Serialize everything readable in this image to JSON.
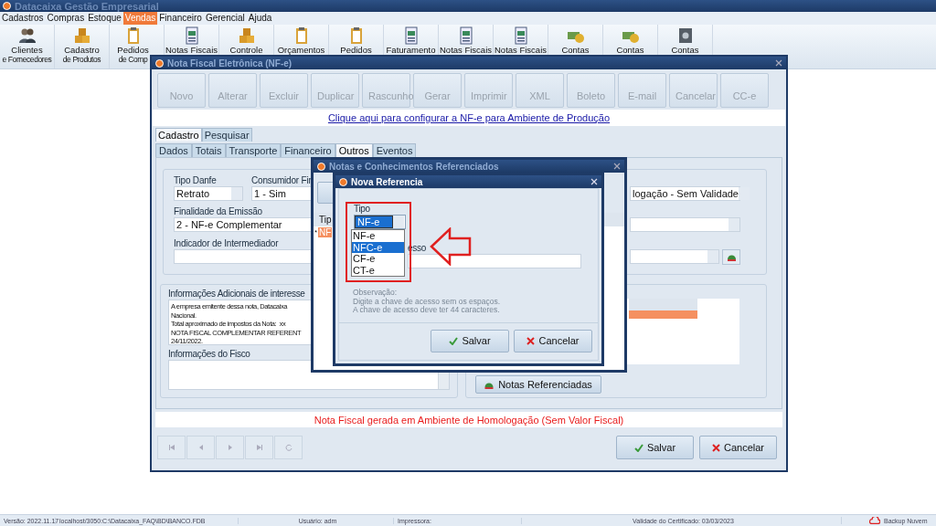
{
  "app": {
    "title": "Datacaixa Gestão Empresarial"
  },
  "menu": [
    {
      "label": "Cadastros",
      "selected": false
    },
    {
      "label": "Compras",
      "selected": false
    },
    {
      "label": "Estoque",
      "selected": false
    },
    {
      "label": "Vendas",
      "selected": true
    },
    {
      "label": "Financeiro",
      "selected": false
    },
    {
      "label": "Gerencial",
      "selected": false
    },
    {
      "label": "Ajuda",
      "selected": false
    }
  ],
  "toolbar": [
    {
      "kind": "people",
      "line1": "Clientes",
      "line2": "e Fornecedores"
    },
    {
      "kind": "boxes",
      "line1": "Cadastro",
      "line2": "de Produtos"
    },
    {
      "kind": "clipboard",
      "line1": "Pedidos",
      "line2": "de Comp"
    },
    {
      "kind": "document",
      "line1": "Notas Fiscais"
    },
    {
      "kind": "boxes",
      "line1": "Controle"
    },
    {
      "kind": "clipboard",
      "line1": "Orçamentos"
    },
    {
      "kind": "clipboard",
      "line1": "Pedidos"
    },
    {
      "kind": "document",
      "line1": "Faturamento"
    },
    {
      "kind": "document",
      "line1": "Notas Fiscais"
    },
    {
      "kind": "document",
      "line1": "Notas Fiscais"
    },
    {
      "kind": "money",
      "line1": "Contas"
    },
    {
      "kind": "money",
      "line1": "Contas"
    },
    {
      "kind": "safe",
      "line1": "Contas"
    }
  ],
  "nfe_window": {
    "title": "Nota Fiscal Eletrônica (NF-e)",
    "actions": [
      {
        "label": "Novo",
        "disabled": true
      },
      {
        "label": "Alterar",
        "disabled": true
      },
      {
        "label": "Excluir",
        "disabled": true
      },
      {
        "label": "Duplicar",
        "disabled": true
      },
      {
        "label": "Rascunho",
        "disabled": true
      },
      {
        "label": "Gerar",
        "disabled": true
      },
      {
        "label": "Imprimir",
        "disabled": true
      },
      {
        "label": "XML",
        "disabled": true
      },
      {
        "label": "Boleto",
        "disabled": true
      },
      {
        "label": "E-mail",
        "disabled": true
      },
      {
        "label": "Cancelar",
        "disabled": true
      },
      {
        "label": "CC-e",
        "disabled": true
      }
    ],
    "config_link": "Clique aqui para configurar a NF-e para Ambiente de Produção",
    "tabs": [
      {
        "label": "Cadastro",
        "selected": true
      },
      {
        "label": "Pesquisar",
        "selected": false
      }
    ],
    "subtabs": [
      {
        "label": "Dados",
        "selected": false
      },
      {
        "label": "Totais",
        "selected": false
      },
      {
        "label": "Transporte",
        "selected": false
      },
      {
        "label": "Financeiro",
        "selected": false
      },
      {
        "label": "Outros",
        "selected": true
      },
      {
        "label": "Eventos",
        "selected": false
      }
    ],
    "tipo_danfe": {
      "label": "Tipo Danfe",
      "value": "Retrato"
    },
    "consumidor_final": {
      "label": "Consumidor Fir",
      "value": "1 - Sim"
    },
    "ambiente": {
      "value": "logação - Sem Validade"
    },
    "finalidade": {
      "label": "Finalidade da Emissão",
      "value": "2 - NF-e Complementar"
    },
    "intermediador": {
      "label": "Indicador de Intermediador"
    },
    "info_adicionais": {
      "label": "Informações Adicionais de interesse",
      "lines": [
        "A empresa emitente dessa nota, Datacaixa",
        "Nacional.",
        "Total aproximado de impostos da Nota:  xx",
        "NOTA FISCAL COMPLEMENTAR REFERENT",
        "24/11/2022."
      ]
    },
    "info_fisco": {
      "label": "Informações do Fisco"
    },
    "referenced_button": "Notas Referenciadas",
    "environment_notice": "Nota Fiscal gerada em Ambiente de Homologação (Sem Valor Fiscal)",
    "buttons": [
      "Salvar",
      "Cancelar"
    ]
  },
  "refs_window": {
    "title": "Notas e Conhecimentos Referenciados",
    "column": "Tip",
    "row_marker": "*",
    "row_cell": "NF"
  },
  "new_ref": {
    "title": "Nova Referencia",
    "tipo_label": "Tipo",
    "tipo_value": "NF-e",
    "options": [
      {
        "label": "NF-e",
        "selected": false
      },
      {
        "label": "NFC-e",
        "selected": true
      },
      {
        "label": "CF-e",
        "selected": false
      },
      {
        "label": "CT-e",
        "selected": false
      }
    ],
    "chave_label": "esso",
    "observacao": [
      "Observação:",
      "Digite a chave de acesso sem os espaços.",
      "A chave de acesso deve ter 44 caracteres."
    ],
    "buttons": [
      "Salvar",
      "Cancelar"
    ]
  },
  "status_bar": {
    "items": [
      "Versão: 2022.11.17",
      "localhost/3050:C:\\Datacaixa_FAQ\\BD\\BANCO.FDB",
      "Usuário: adm",
      "Impressora:",
      "Validade do Certificado: 03/03/2023"
    ],
    "backup": "Backup Nuvem"
  }
}
